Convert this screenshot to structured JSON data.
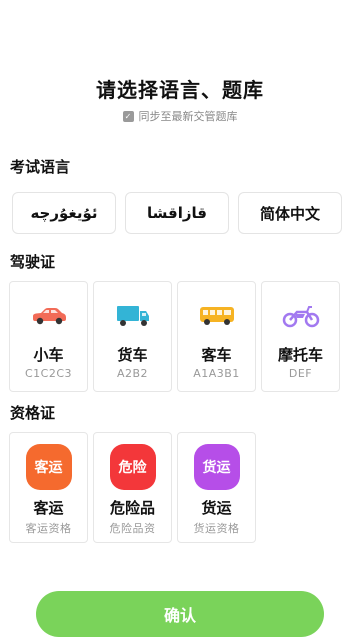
{
  "header": {
    "title": "请选择语言、题库",
    "sync_label": "同步至最新交管题库",
    "sync_checked": true
  },
  "sections": {
    "language": "考试语言",
    "license": "驾驶证",
    "qualification": "资格证"
  },
  "languages": [
    "ئۇيغۇرچە",
    "قازاقشا",
    "简体中文"
  ],
  "licenses": [
    {
      "name": "小车",
      "sub": "C1C2C3",
      "icon": "car-icon",
      "color": "#f26b57"
    },
    {
      "name": "货车",
      "sub": "A2B2",
      "icon": "truck-icon",
      "color": "#33b4d6"
    },
    {
      "name": "客车",
      "sub": "A1A3B1",
      "icon": "bus-icon",
      "color": "#f6b323"
    },
    {
      "name": "摩托车",
      "sub": "DEF",
      "icon": "motorcycle-icon",
      "color": "#a279f0"
    }
  ],
  "qualifications": [
    {
      "badge": "客运",
      "name": "客运",
      "sub": "客运资格",
      "color": "#f56a2e"
    },
    {
      "badge": "危险",
      "name": "危险品",
      "sub": "危险品资",
      "color": "#f3373a"
    },
    {
      "badge": "货运",
      "name": "货运",
      "sub": "货运资格",
      "color": "#b64ee8"
    }
  ],
  "footer": {
    "confirm_label": "确认",
    "confirm_color": "#7ad35a"
  }
}
